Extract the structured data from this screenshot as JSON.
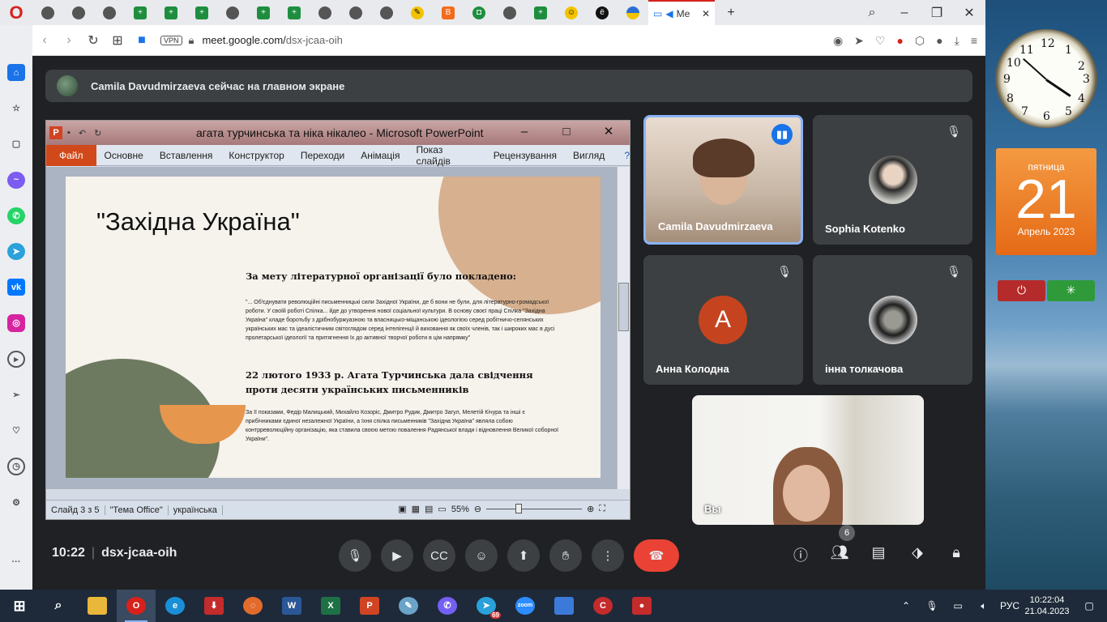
{
  "browser": {
    "active_tab": "Me",
    "tab_icons": [
      "tab",
      "tab",
      "tab",
      "doc",
      "doc",
      "doc",
      "tab",
      "doc",
      "doc",
      "tab",
      "tab",
      "tab",
      "pen",
      "tab",
      "blogger",
      "shield",
      "tab",
      "doc",
      "face",
      "e",
      "ua",
      "img",
      "meet"
    ],
    "url_domain": "meet.google.com/",
    "url_path": "dsx-jcaa-oih",
    "vpn": "VPN"
  },
  "presenting_banner": "Camila Davudmirzaeva сейчас на главном экране",
  "ppt": {
    "title": "агата турчинська та ніка нікалео - Microsoft PowerPoint",
    "ribbon_file": "Файл",
    "ribbon_tabs": [
      "Основне",
      "Вставлення",
      "Конструктор",
      "Переходи",
      "Анімація",
      "Показ слайдів",
      "Рецензування",
      "Вигляд"
    ],
    "slide": {
      "title": "\"Західна Україна\"",
      "heading1": "За мету літературної організації було покладено:",
      "para1": "\"... Об'єднувати революційні письменницькі сили Західної України, де б вони не були, для літературно-громадської роботи. У своїй роботі Спілка... йде до утворення нової соціальної культури. В основу своєї праці Спілка \"Західна Україна\" кладе боротьбу з дрібнобуржуазною та власницько-міщанською ідеологією серед робітничо-селянських українських мас та ідеалістичним світоглядом серед інтелігенції й виховання як своїх членів, так і широких мас в дусі пролетарської ідеології та притягнення їх до активної творчої роботи в цім напрямку\"",
      "heading2": "22 лютого 1933 р. Агата Турчинська дала свідчення проти десяти українських письменників",
      "para2": "За її показами, Федір Малицький, Михайло Козоріс, Дмитро Рудик, Дмитро Загул, Мелетій Кічура та інші є прибічниками єдиної незалежної України, а їхня спілка письменників \"Західна Україна\" являла собою контрреволюційну організацію, яка ставила своєю метою повалення Радянської влади і відновлення Великої соборної України\"."
    },
    "status": {
      "slide": "Слайд 3 з 5",
      "theme": "\"Тема Office\"",
      "lang": "українська",
      "zoom": "55%"
    }
  },
  "participants": [
    {
      "name": "Camila Davudmirzaeva",
      "speaking": true
    },
    {
      "name": "Sophia Kotenko",
      "muted": true
    },
    {
      "name": "Анна Колодна",
      "initial": "A",
      "muted": true
    },
    {
      "name": "інна толкачова",
      "muted": true
    },
    {
      "name": "Вы"
    }
  ],
  "meeting": {
    "time": "10:22",
    "code": "dsx-jcaa-oih",
    "people_count": "6"
  },
  "gadgets": {
    "clock_numbers": [
      "12",
      "1",
      "2",
      "3",
      "4",
      "5",
      "6",
      "7",
      "8",
      "9",
      "10",
      "11"
    ],
    "calendar": {
      "weekday": "пятница",
      "day": "21",
      "month": "Апрель 2023"
    }
  },
  "taskbar": {
    "badge": "69",
    "lang": "РУС",
    "time": "10:22:04",
    "date": "21.04.2023"
  }
}
